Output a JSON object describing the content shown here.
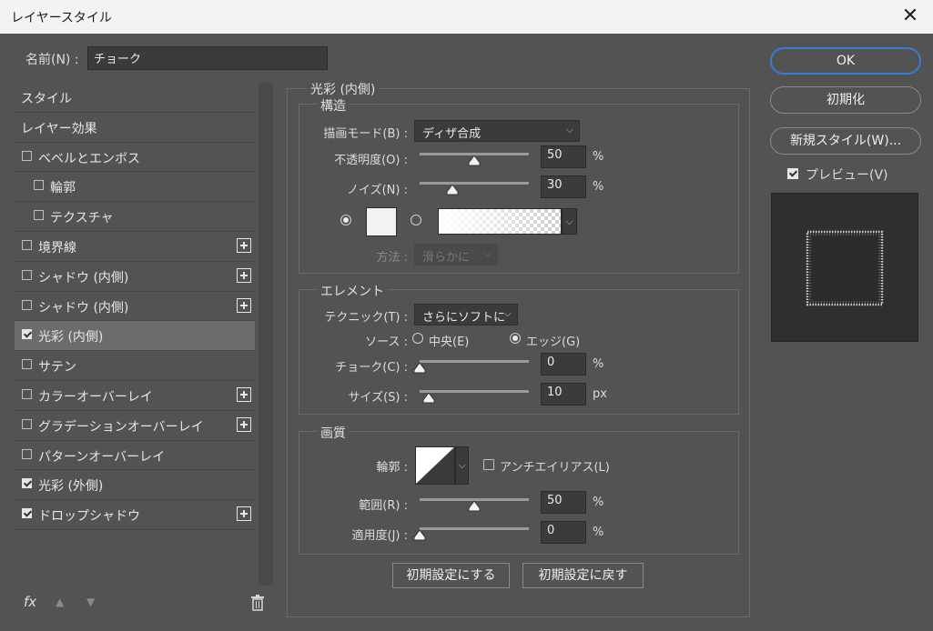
{
  "window": {
    "title": "レイヤースタイル",
    "close_glyph": "✕"
  },
  "name": {
    "label": "名前(N) :",
    "value": "チョーク"
  },
  "left_list": [
    {
      "label": "スタイル",
      "checkbox": false,
      "checked": false,
      "plus": false,
      "selected": false
    },
    {
      "label": "レイヤー効果",
      "checkbox": false,
      "checked": false,
      "plus": false,
      "selected": false
    },
    {
      "label": "ベベルとエンボス",
      "checkbox": true,
      "checked": false,
      "plus": false,
      "selected": false
    },
    {
      "label": "輪郭",
      "checkbox": true,
      "checked": false,
      "plus": false,
      "selected": false,
      "indent": true
    },
    {
      "label": "テクスチャ",
      "checkbox": true,
      "checked": false,
      "plus": false,
      "selected": false,
      "indent": true
    },
    {
      "label": "境界線",
      "checkbox": true,
      "checked": false,
      "plus": true,
      "selected": false
    },
    {
      "label": "シャドウ (内側)",
      "checkbox": true,
      "checked": false,
      "plus": true,
      "selected": false
    },
    {
      "label": "シャドウ (内側)",
      "checkbox": true,
      "checked": false,
      "plus": true,
      "selected": false
    },
    {
      "label": "光彩 (内側)",
      "checkbox": true,
      "checked": true,
      "plus": false,
      "selected": true
    },
    {
      "label": "サテン",
      "checkbox": true,
      "checked": false,
      "plus": false,
      "selected": false
    },
    {
      "label": "カラーオーバーレイ",
      "checkbox": true,
      "checked": false,
      "plus": true,
      "selected": false
    },
    {
      "label": "グラデーションオーバーレイ",
      "checkbox": true,
      "checked": false,
      "plus": true,
      "selected": false
    },
    {
      "label": "パターンオーバーレイ",
      "checkbox": true,
      "checked": false,
      "plus": false,
      "selected": false
    },
    {
      "label": "光彩 (外側)",
      "checkbox": true,
      "checked": true,
      "plus": false,
      "selected": false
    },
    {
      "label": "ドロップシャドウ",
      "checkbox": true,
      "checked": true,
      "plus": true,
      "selected": false
    }
  ],
  "footer_icons": {
    "fx": "fx",
    "up": "▲",
    "down": "▼",
    "trash": "🗑"
  },
  "panel": {
    "title": "光彩 (内側)",
    "structure": {
      "title": "構造",
      "blend_label": "描画モード(B) :",
      "blend_value": "ディザ合成",
      "opacity_label": "不透明度(O) :",
      "opacity_value": "50",
      "opacity_level": 50,
      "noise_label": "ノイズ(N) :",
      "noise_value": "30",
      "noise_level": 30,
      "percent": "%",
      "method_label": "方法 :",
      "method_value": "滑らかに"
    },
    "elements": {
      "title": "エレメント",
      "technique_label": "テクニック(T) :",
      "technique_value": "さらにソフトに",
      "source_label": "ソース :",
      "source_center": "中央(E)",
      "source_edge": "エッジ(G)",
      "choke_label": "チョーク(C) :",
      "choke_value": "0",
      "choke_level": 0,
      "size_label": "サイズ(S) :",
      "size_value": "10",
      "size_level": 8,
      "px": "px"
    },
    "quality": {
      "title": "画質",
      "contour_label": "輪郭 :",
      "antialias_label": "アンチエイリアス(L)",
      "range_label": "範囲(R) :",
      "range_value": "50",
      "range_level": 50,
      "jitter_label": "適用度(J) :",
      "jitter_value": "0",
      "jitter_level": 0
    },
    "make_default": "初期設定にする",
    "reset_default": "初期設定に戻す"
  },
  "right": {
    "ok": "OK",
    "reset": "初期化",
    "new_style": "新規スタイル(W)...",
    "preview_label": "プレビュー(V)",
    "preview_checked": true
  },
  "colors": {
    "accent": "#3a7bd5",
    "bg": "#535353"
  }
}
